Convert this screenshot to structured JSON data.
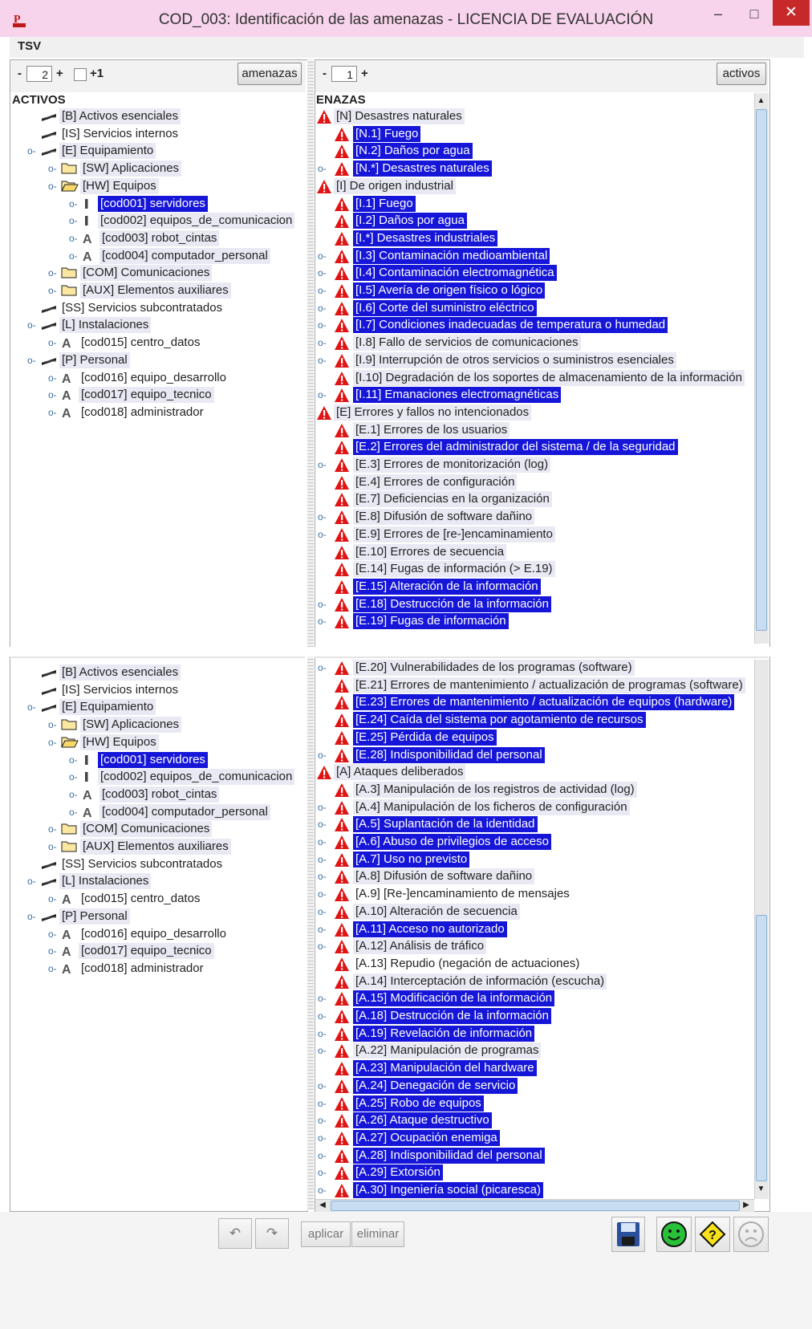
{
  "window": {
    "title": "COD_003: Identificación de las amenazas - LICENCIA DE EVALUACIÓN",
    "min": "–",
    "max": "□",
    "close": "✕"
  },
  "menu": {
    "tsv": "TSV"
  },
  "left_toolbar": {
    "minus": "-",
    "spinner_value": "2",
    "plus": "+",
    "plus_one": "+1",
    "amenazas_button": "amenazas",
    "header": "ACTIVOS"
  },
  "right_toolbar": {
    "minus": "-",
    "spinner_value": "1",
    "plus": "+",
    "activos_button": "activos",
    "header": "ENAZAS"
  },
  "assets_tree": [
    {
      "label": "[B] Activos esenciales",
      "indent": 0,
      "icon": "layer-icon",
      "knob": "",
      "state": "soft"
    },
    {
      "label": "[IS] Servicios internos",
      "indent": 0,
      "icon": "layer-icon",
      "knob": "",
      "state": ""
    },
    {
      "label": "[E] Equipamiento",
      "indent": 0,
      "icon": "layer-icon",
      "knob": "open",
      "state": "soft"
    },
    {
      "label": "[SW] Aplicaciones",
      "indent": 1,
      "icon": "folder-icon",
      "knob": "closed",
      "state": "soft"
    },
    {
      "label": "[HW] Equipos",
      "indent": 1,
      "icon": "folder-open-icon",
      "knob": "open",
      "state": "soft"
    },
    {
      "label": "[cod001] servidores",
      "indent": 2,
      "icon": "bar-icon",
      "knob": "closed",
      "state": "hl"
    },
    {
      "label": "[cod002] equipos_de_comunicacion",
      "indent": 2,
      "icon": "bar-icon",
      "knob": "closed",
      "state": "soft"
    },
    {
      "label": "[cod003] robot_cintas",
      "indent": 2,
      "icon": "a-icon",
      "knob": "closed",
      "state": "soft"
    },
    {
      "label": "[cod004] computador_personal",
      "indent": 2,
      "icon": "a-icon",
      "knob": "closed",
      "state": "soft"
    },
    {
      "label": "[COM] Comunicaciones",
      "indent": 1,
      "icon": "folder-icon",
      "knob": "closed",
      "state": "soft"
    },
    {
      "label": "[AUX] Elementos auxiliares",
      "indent": 1,
      "icon": "folder-icon",
      "knob": "closed",
      "state": "soft"
    },
    {
      "label": "[SS] Servicios subcontratados",
      "indent": 0,
      "icon": "layer-icon",
      "knob": "",
      "state": ""
    },
    {
      "label": "[L] Instalaciones",
      "indent": 0,
      "icon": "layer-icon",
      "knob": "open",
      "state": "soft"
    },
    {
      "label": "[cod015] centro_datos",
      "indent": 1,
      "icon": "a-icon",
      "knob": "closed",
      "state": ""
    },
    {
      "label": "[P] Personal",
      "indent": 0,
      "icon": "layer-icon",
      "knob": "open",
      "state": "soft"
    },
    {
      "label": "[cod016] equipo_desarrollo",
      "indent": 1,
      "icon": "a-icon",
      "knob": "closed",
      "state": ""
    },
    {
      "label": "[cod017] equipo_tecnico",
      "indent": 1,
      "icon": "a-icon",
      "knob": "closed",
      "state": "soft"
    },
    {
      "label": "[cod018] administrador",
      "indent": 1,
      "icon": "a-icon",
      "knob": "closed",
      "state": ""
    }
  ],
  "threats_top": [
    {
      "label": "[N] Desastres naturales",
      "group": true,
      "knob": false,
      "state": "soft"
    },
    {
      "label": "[N.1] Fuego",
      "group": false,
      "knob": false,
      "state": "hl"
    },
    {
      "label": "[N.2] Daños por agua",
      "group": false,
      "knob": false,
      "state": "hl"
    },
    {
      "label": "[N.*] Desastres naturales",
      "group": false,
      "knob": true,
      "state": "hl"
    },
    {
      "label": "[I] De origen industrial",
      "group": true,
      "knob": false,
      "state": "soft"
    },
    {
      "label": "[I.1] Fuego",
      "group": false,
      "knob": false,
      "state": "hl"
    },
    {
      "label": "[I.2] Daños por agua",
      "group": false,
      "knob": false,
      "state": "hl"
    },
    {
      "label": "[I.*] Desastres industriales",
      "group": false,
      "knob": false,
      "state": "hl"
    },
    {
      "label": "[I.3] Contaminación medioambiental",
      "group": false,
      "knob": true,
      "state": "hl"
    },
    {
      "label": "[I.4] Contaminación electromagnética",
      "group": false,
      "knob": true,
      "state": "hl"
    },
    {
      "label": "[I.5] Avería de origen físico o lógico",
      "group": false,
      "knob": true,
      "state": "hl"
    },
    {
      "label": "[I.6] Corte del suministro eléctrico",
      "group": false,
      "knob": true,
      "state": "hl"
    },
    {
      "label": "[I.7] Condiciones inadecuadas de temperatura o humedad",
      "group": false,
      "knob": true,
      "state": "hl"
    },
    {
      "label": "[I.8] Fallo de servicios de comunicaciones",
      "group": false,
      "knob": true,
      "state": "soft"
    },
    {
      "label": "[I.9] Interrupción de otros servicios o suministros esenciales",
      "group": false,
      "knob": true,
      "state": "soft"
    },
    {
      "label": "[I.10] Degradación de los soportes de almacenamiento de la información",
      "group": false,
      "knob": false,
      "state": "soft"
    },
    {
      "label": "[I.11] Emanaciones electromagnéticas",
      "group": false,
      "knob": true,
      "state": "hl"
    },
    {
      "label": "[E] Errores y fallos no intencionados",
      "group": true,
      "knob": false,
      "state": "soft"
    },
    {
      "label": "[E.1] Errores de los usuarios",
      "group": false,
      "knob": false,
      "state": "soft"
    },
    {
      "label": "[E.2] Errores del administrador del sistema / de la seguridad",
      "group": false,
      "knob": false,
      "state": "hl"
    },
    {
      "label": "[E.3] Errores de monitorización (log)",
      "group": false,
      "knob": true,
      "state": "soft"
    },
    {
      "label": "[E.4] Errores de configuración",
      "group": false,
      "knob": false,
      "state": "soft"
    },
    {
      "label": "[E.7] Deficiencias en la organización",
      "group": false,
      "knob": false,
      "state": "soft"
    },
    {
      "label": "[E.8] Difusión de software dañino",
      "group": false,
      "knob": true,
      "state": "soft"
    },
    {
      "label": "[E.9] Errores de [re-]encaminamiento",
      "group": false,
      "knob": true,
      "state": "soft"
    },
    {
      "label": "[E.10] Errores de secuencia",
      "group": false,
      "knob": false,
      "state": "soft"
    },
    {
      "label": "[E.14] Fugas de información (> E.19)",
      "group": false,
      "knob": false,
      "state": "soft"
    },
    {
      "label": "[E.15] Alteración de la información",
      "group": false,
      "knob": false,
      "state": "hl"
    },
    {
      "label": "[E.18] Destrucción de la información",
      "group": false,
      "knob": true,
      "state": "hl"
    },
    {
      "label": "[E.19] Fugas de información",
      "group": false,
      "knob": true,
      "state": "hl"
    }
  ],
  "threats_bottom": [
    {
      "label": "[E.20] Vulnerabilidades de los programas (software)",
      "group": false,
      "knob": true,
      "state": "soft"
    },
    {
      "label": "[E.21] Errores de mantenimiento / actualización de programas (software)",
      "group": false,
      "knob": false,
      "state": "soft"
    },
    {
      "label": "[E.23] Errores de mantenimiento / actualización de equipos (hardware)",
      "group": false,
      "knob": false,
      "state": "hl"
    },
    {
      "label": "[E.24] Caída del sistema por agotamiento de recursos",
      "group": false,
      "knob": false,
      "state": "hl"
    },
    {
      "label": "[E.25] Pérdida de equipos",
      "group": false,
      "knob": false,
      "state": "hl"
    },
    {
      "label": "[E.28] Indisponibilidad del personal",
      "group": false,
      "knob": true,
      "state": "hl"
    },
    {
      "label": "[A] Ataques deliberados",
      "group": true,
      "knob": false,
      "state": "soft"
    },
    {
      "label": "[A.3] Manipulación de los registros de actividad (log)",
      "group": false,
      "knob": false,
      "state": "soft"
    },
    {
      "label": "[A.4] Manipulación de los ficheros de configuración",
      "group": false,
      "knob": true,
      "state": "soft"
    },
    {
      "label": "[A.5] Suplantación de la identidad",
      "group": false,
      "knob": true,
      "state": "hl"
    },
    {
      "label": "[A.6] Abuso de privilegios de acceso",
      "group": false,
      "knob": true,
      "state": "hl"
    },
    {
      "label": "[A.7] Uso no previsto",
      "group": false,
      "knob": true,
      "state": "hl"
    },
    {
      "label": "[A.8] Difusión de software dañino",
      "group": false,
      "knob": true,
      "state": "soft"
    },
    {
      "label": "[A.9] [Re-]encaminamiento de mensajes",
      "group": false,
      "knob": true,
      "state": ""
    },
    {
      "label": "[A.10] Alteración de secuencia",
      "group": false,
      "knob": true,
      "state": "soft"
    },
    {
      "label": "[A.11] Acceso no autorizado",
      "group": false,
      "knob": true,
      "state": "hl"
    },
    {
      "label": "[A.12] Análisis de tráfico",
      "group": false,
      "knob": true,
      "state": "soft"
    },
    {
      "label": "[A.13] Repudio (negación de actuaciones)",
      "group": false,
      "knob": false,
      "state": ""
    },
    {
      "label": "[A.14] Interceptación de información (escucha)",
      "group": false,
      "knob": false,
      "state": "soft"
    },
    {
      "label": "[A.15] Modificación de la información",
      "group": false,
      "knob": true,
      "state": "hl"
    },
    {
      "label": "[A.18] Destrucción de la información",
      "group": false,
      "knob": true,
      "state": "hl"
    },
    {
      "label": "[A.19] Revelación de información",
      "group": false,
      "knob": true,
      "state": "hl"
    },
    {
      "label": "[A.22] Manipulación de programas",
      "group": false,
      "knob": true,
      "state": "soft"
    },
    {
      "label": "[A.23] Manipulación del hardware",
      "group": false,
      "knob": false,
      "state": "hl"
    },
    {
      "label": "[A.24] Denegación de servicio",
      "group": false,
      "knob": true,
      "state": "hl"
    },
    {
      "label": "[A.25] Robo de equipos",
      "group": false,
      "knob": true,
      "state": "hl"
    },
    {
      "label": "[A.26] Ataque destructivo",
      "group": false,
      "knob": true,
      "state": "hl"
    },
    {
      "label": "[A.27] Ocupación enemiga",
      "group": false,
      "knob": true,
      "state": "hl"
    },
    {
      "label": "[A.28] Indisponibilidad del personal",
      "group": false,
      "knob": true,
      "state": "hl"
    },
    {
      "label": "[A.29] Extorsión",
      "group": false,
      "knob": true,
      "state": "hl"
    },
    {
      "label": "[A.30] Ingeniería social (picaresca)",
      "group": false,
      "knob": true,
      "state": "hl"
    }
  ],
  "bottom_bar": {
    "undo": "↶",
    "redo": "↷",
    "apply": "aplicar",
    "delete": "eliminar"
  },
  "colors": {
    "selection": "#1616d8",
    "titlebar": "#f7d4ec",
    "close": "#c7292b",
    "warning": "#e01414"
  }
}
